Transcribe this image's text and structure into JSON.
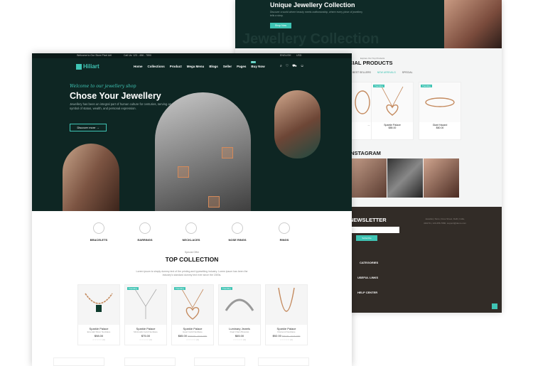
{
  "back": {
    "hero_title": "Unique Jewellery Collection",
    "hero_desc": "Discover a world where beauty meets craftsmanship, where every piece of jewellery tells a story.",
    "hero_button": "Shop Now",
    "hero_watermark": "Jewellery Collection",
    "special_sub": "Explore Our Top Products",
    "special_title": "CIAL PRODUCTS",
    "tabs": [
      "BEST SELLERS",
      "NEW ARRIVALS",
      "SPECIAL"
    ],
    "cards": [
      {
        "badge": "",
        "name": "...",
        "sub": "",
        "price": ""
      },
      {
        "badge": "Trending",
        "name": "Sparkle Palace",
        "sub": "Diamond Necklace",
        "price": "$85.00"
      },
      {
        "badge": "Trending",
        "name": "Giant Hazard",
        "sub": "Dome Ring Bracelet",
        "price": "$60.00"
      }
    ],
    "insta_title": "INSTAGRAM",
    "newsletter_title": "NEWSLETTER",
    "newsletter_placeholder": "Enter Email Here",
    "subscribe": "Subscribe",
    "footer_headings": [
      "CATEGORIES",
      "USEFUL LINKS",
      "HELP CENTER"
    ],
    "footer_info": "Jewellery Store, Dove Street, Delhi, India, 4422.51, 123-456-7890, support@demo.com"
  },
  "front": {
    "topbar": {
      "welcome": "Welcome to Our Store Pixel Art!",
      "call": "Call Us: 123 - 456 - 7890",
      "language": "ENGLISH",
      "currency": "USD"
    },
    "logo": "Hiliart",
    "nav": [
      "Home",
      "Collections",
      "Product",
      "Mega Menu",
      "Blogs",
      "Seller",
      "Pages",
      "Buy Now"
    ],
    "buy_badge": "Hot",
    "hero": {
      "hello": "Welcome to our jewellery shop",
      "title": "Chose Your Jewellery",
      "desc": "Jewellery has been an integral part of human culture for centuries, serving as a symbol of status, wealth, and personal expression.",
      "button": "Discover more"
    },
    "categories": [
      "BRACELETS",
      "EARRINGS",
      "NECKLACES",
      "NOSE RINGS",
      "RINGS"
    ],
    "section": {
      "sub": "Special Offer",
      "title": "TOP COLLECTION",
      "desc": "Lorem ipsum is simply dummy text of the printing and typesetting industry. Lorem ipsum has been the industry's standard dummy text ever since the 1500s."
    },
    "products": [
      {
        "badge": "",
        "name": "Sparkle Palace",
        "sub": "Emerald Silver Necklace",
        "price": "$98.00",
        "old": "",
        "rating": "☆☆☆☆☆ (0)"
      },
      {
        "badge": "Trending",
        "name": "Sparkle Palace",
        "sub": "Minimalist Gold Necklace",
        "price": "$75.00",
        "old": "",
        "rating": "☆☆☆☆☆ (0)"
      },
      {
        "badge": "Trending",
        "name": "Sparkle Palace",
        "sub": "Heart Gold Necklace",
        "price": "$65.00",
        "old": "$100.00 - 10 % OFF",
        "rating": "☆☆☆☆☆ (0)"
      },
      {
        "badge": "Trending",
        "name": "Luminary Jewels",
        "sub": "Dual Chain Bracelet",
        "price": "$65.00",
        "old": "",
        "rating": "☆☆☆☆☆ (0)"
      },
      {
        "badge": "",
        "name": "Sparkle Palace",
        "sub": "Diamond Necklace",
        "price": "$92.00",
        "old": "$99.00 - 10 % OFF",
        "rating": "☆☆☆☆☆ (0)"
      }
    ]
  },
  "colors": {
    "accent": "#3fc4b4",
    "hero_bg": "#0e2623",
    "footer_bg": "#322c27"
  }
}
